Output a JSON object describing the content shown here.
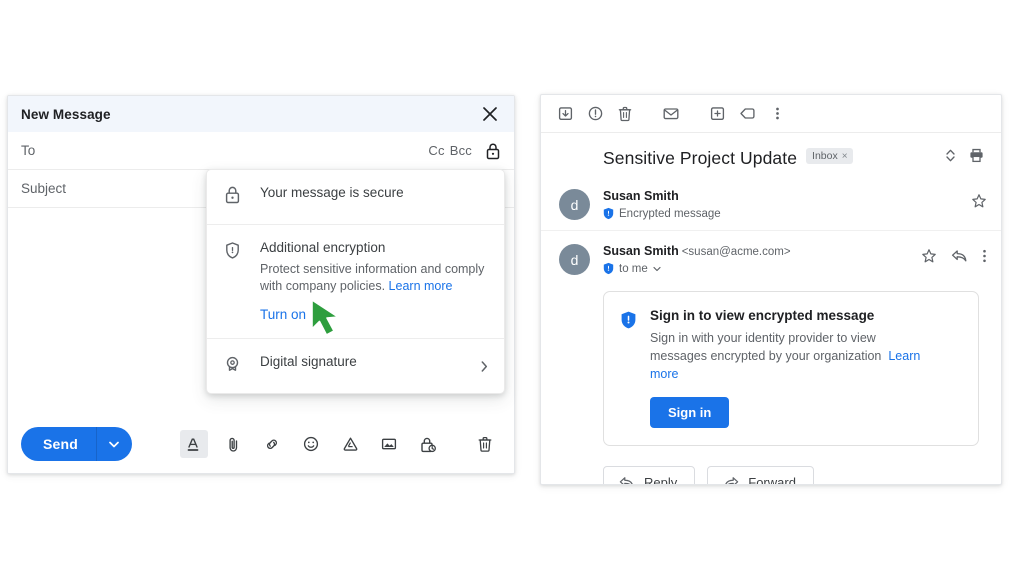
{
  "compose": {
    "title": "New Message",
    "close_icon": "close-icon",
    "to_label": "To",
    "cc_label": "Cc",
    "bcc_label": "Bcc",
    "lock_icon": "lock-icon",
    "subject_label": "Subject",
    "send_label": "Send",
    "send_caret_icon": "chevron-down-icon",
    "toolbar_icons": [
      "format-text-icon",
      "attach-file-icon",
      "insert-link-icon",
      "insert-emoji-icon",
      "insert-drive-icon",
      "insert-photo-icon",
      "confidential-mode-icon",
      "delete-draft-icon"
    ]
  },
  "security_menu": {
    "items": [
      {
        "icon": "lock-icon",
        "title": "Your message is secure",
        "sub": "",
        "link": "",
        "action": "",
        "arrow": false
      },
      {
        "icon": "shield-icon",
        "title": "Additional encryption",
        "sub": "Protect sensitive information and comply with company policies.",
        "link": "Learn more",
        "action": "Turn on",
        "arrow": false
      },
      {
        "icon": "digital-signature-icon",
        "title": "Digital signature",
        "sub": "",
        "link": "",
        "action": "",
        "arrow": true
      }
    ]
  },
  "cursor": {
    "name": "green-arrow-cursor",
    "color": "#2e9e3e"
  },
  "reader": {
    "toolbar_icons": [
      "archive-icon",
      "report-spam-icon",
      "delete-icon",
      "mark-unread-icon",
      "snooze-icon",
      "label-icon",
      "more-options-icon"
    ],
    "subject": "Sensitive Project Update",
    "label_chip": "Inbox",
    "label_chip_remove": "×",
    "expand_icon": "expand-collapse-icon",
    "print_icon": "print-icon",
    "messages": [
      {
        "avatar_letter": "d",
        "name": "Susan Smith",
        "email": "",
        "status_icon": "encrypted-shield-icon",
        "status": "Encrypted message",
        "actions": [
          "star-icon"
        ]
      },
      {
        "avatar_letter": "d",
        "name": "Susan Smith",
        "email": "<susan@acme.com>",
        "status_icon": "encrypted-shield-icon",
        "status": "to me",
        "status_caret": "chevron-down-icon",
        "actions": [
          "star-icon",
          "reply-icon",
          "more-options-icon"
        ]
      }
    ],
    "signin_card": {
      "icon": "shield-filled-icon",
      "title": "Sign in to view encrypted message",
      "text": "Sign in with your identity provider to view messages encrypted by your organization",
      "link": "Learn more",
      "button": "Sign in"
    },
    "footer": {
      "reply_icon": "reply-icon",
      "reply_label": "Reply",
      "forward_icon": "forward-icon",
      "forward_label": "Forward"
    }
  },
  "colors": {
    "accent": "#1a73e8",
    "header_bg": "#f2f6fc",
    "avatar": "#7a8a99",
    "cursor_green": "#2e9e3e",
    "muted_text": "#5f6368"
  }
}
